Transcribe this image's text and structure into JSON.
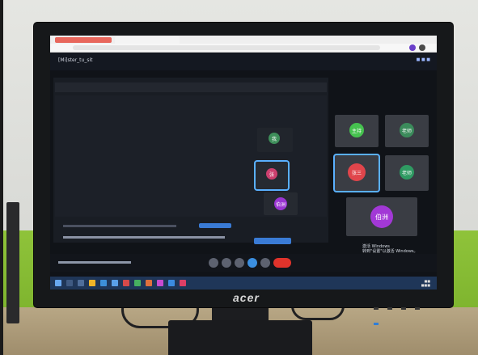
{
  "monitor": {
    "brand": "acer"
  },
  "meeting": {
    "title": "[Mi]ster_tu_sit"
  },
  "tiles": [
    {
      "label": "主持",
      "color": "#46c24f"
    },
    {
      "label": "老师",
      "color": "#3b8b5b"
    },
    {
      "label": "张三",
      "color": "#e0454b"
    },
    {
      "label": "老师",
      "color": "#2f9a62"
    },
    {
      "label": "伯洲",
      "color": "#a238d6"
    }
  ],
  "share_area": {
    "tiles": [
      {
        "label": "我",
        "color": "#3e8e5a"
      },
      {
        "label": "张",
        "color": "#cc3f6e"
      },
      {
        "label": "伯洲",
        "color": "#9a35d2"
      }
    ]
  },
  "watermark": {
    "line1": "激活 Windows",
    "line2": "转到\"设置\"以激活 Windows。"
  }
}
